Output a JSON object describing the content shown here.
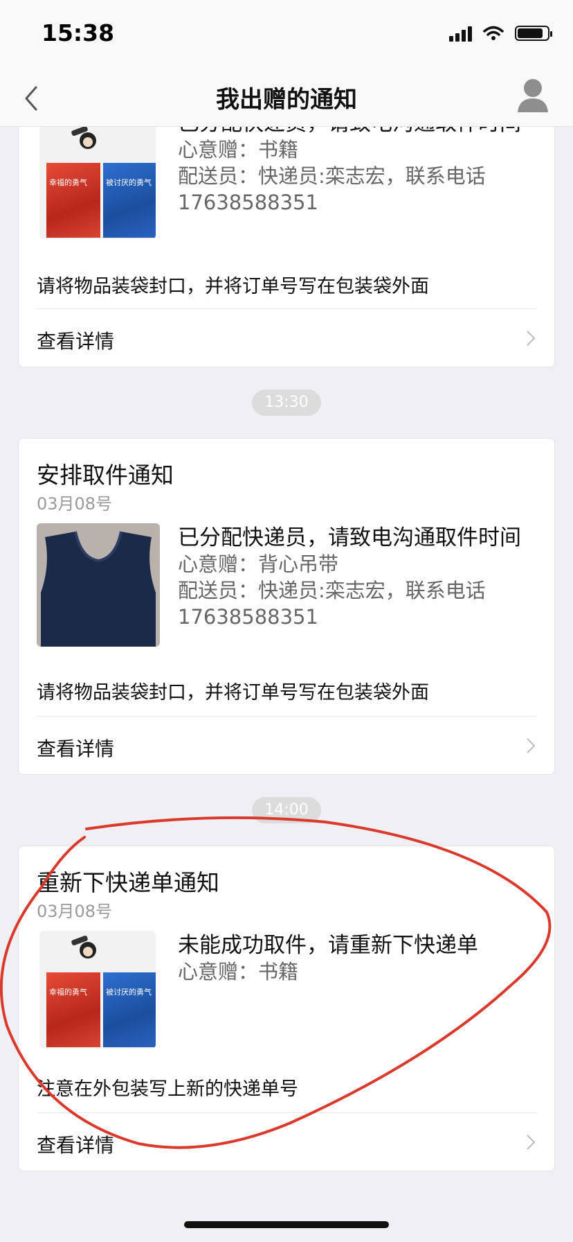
{
  "status_bar": {
    "time": "15:38"
  },
  "nav": {
    "title": "我出赠的通知"
  },
  "cards": [
    {
      "main": "已分配快递员，请致电沟通取件时间",
      "gift": "心意赠：书籍",
      "courier": "配送员：快递员:栾志宏，联系电话 17638588351",
      "note": "请将物品装袋封口，并将订单号写在包装袋外面",
      "detail": "查看详情",
      "thumbnail": "books"
    },
    {
      "time": "13:30",
      "title": "安排取件通知",
      "date": "03月08号",
      "main": "已分配快递员，请致电沟通取件时间",
      "gift": "心意赠：背心吊带",
      "courier": "配送员：快递员:栾志宏，联系电话 17638588351",
      "note": "请将物品装袋封口，并将订单号写在包装袋外面",
      "detail": "查看详情",
      "thumbnail": "vest"
    },
    {
      "time": "14:00",
      "title": "重新下快递单通知",
      "date": "03月08号",
      "main": "未能成功取件，请重新下快递单",
      "gift": "心意赠：书籍",
      "note": "注意在外包装写上新的快递单号",
      "detail": "查看详情",
      "thumbnail": "books"
    }
  ],
  "book_labels": {
    "red": "幸福的勇气",
    "blue": "被讨厌的勇气"
  },
  "annotation_color": "#d93a2b"
}
